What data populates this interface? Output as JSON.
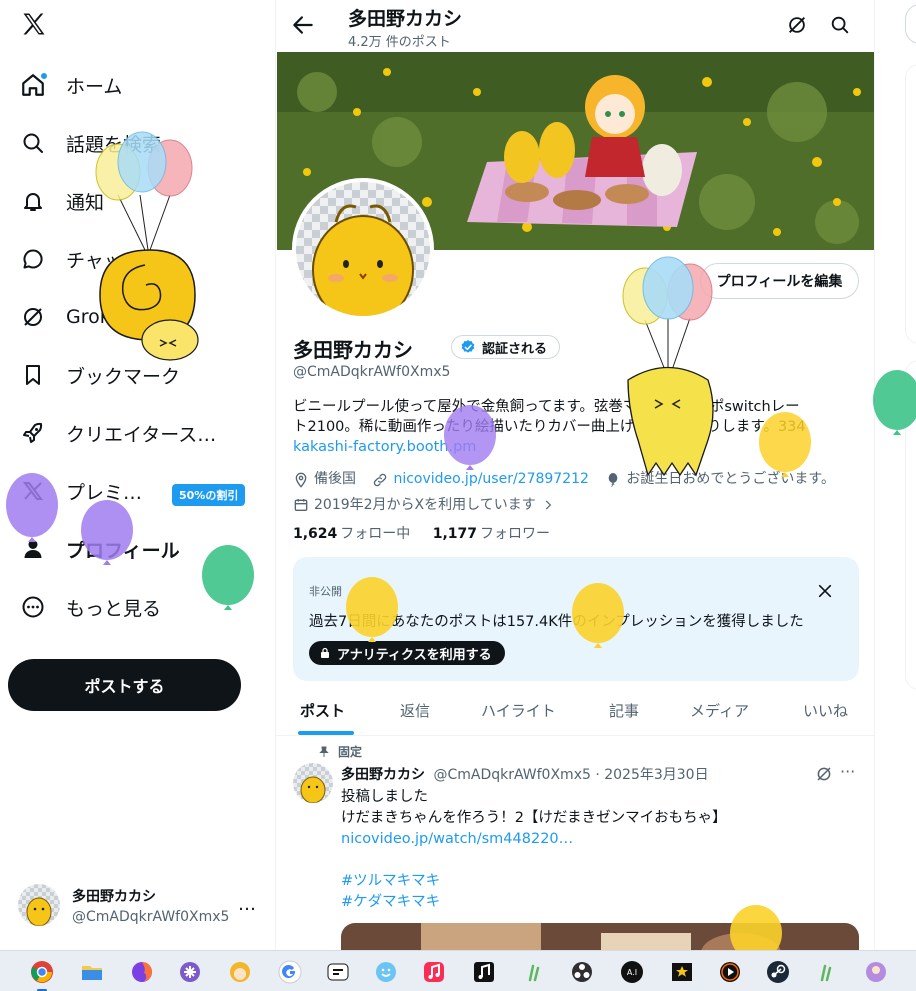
{
  "sidebar": {
    "logo": "x-logo-icon",
    "items": [
      {
        "label": "ホーム",
        "icon": "home-icon"
      },
      {
        "label": "話題を検索",
        "icon": "search-icon"
      },
      {
        "label": "通知",
        "icon": "bell-icon"
      },
      {
        "label": "チャット",
        "icon": "chat-icon"
      },
      {
        "label": "Grok",
        "icon": "grok-icon"
      },
      {
        "label": "ブックマーク",
        "icon": "bookmark-icon"
      },
      {
        "label": "クリエイタース…",
        "icon": "rocket-icon"
      },
      {
        "label": "プレミ…",
        "icon": "x-premium-icon"
      },
      {
        "label": "プロフィール",
        "icon": "person-icon"
      },
      {
        "label": "もっと見る",
        "icon": "more-circle-icon"
      }
    ],
    "premium_badge": "50%の割引",
    "post_button": "ポストする",
    "account": {
      "name": "多田野カカシ",
      "handle": "@CmADqkrAWf0Xmx5",
      "more": "…"
    }
  },
  "header": {
    "title": "多田野カカシ",
    "post_count": "4.2万 件のポスト"
  },
  "profile": {
    "edit_button": "プロフィールを編集",
    "name": "多田野カカシ",
    "verified_label": "認証される",
    "handle": "@CmADqkrAWf0Xmx5",
    "bio_line1": "ビニールプール使って屋外で金魚飼ってます。弦巻マキのぷよスポswitchレー",
    "bio_line2": "ト2100。稀に動画作ったり絵描いたりカバー曲上げたり歌ったりします。334",
    "bio_link": "kakashi-factory.booth.pm",
    "location": "備後国",
    "website": "nicovideo.jp/user/27897212",
    "birthday": "お誕生日おめでとうございます。",
    "joined": "2019年2月からXを利用しています",
    "following_count": "1,624",
    "following_label": "フォロー中",
    "followers_count": "1,177",
    "followers_label": "フォロワー"
  },
  "analytics": {
    "private_label": "非公開",
    "message": "過去7日間にあなたのポストは157.4K件のインプレッションを獲得しました",
    "button": "アナリティクスを利用する"
  },
  "tabs": [
    "ポスト",
    "返信",
    "ハイライト",
    "記事",
    "メディア",
    "いいね"
  ],
  "tweet": {
    "pinned_label": "固定",
    "author": "多田野カカシ",
    "handle_date": "@CmADqkrAWf0Xmx5 · 2025年3月30日",
    "line1": "投稿しました",
    "line2": "けだまきちゃんを作ろう！2【けだまきゼンマイおもちゃ】",
    "link": "nicovideo.jp/watch/sm448220…",
    "tag1": "#ツルマキマキ",
    "tag2": "#ケダマキマキ",
    "more": "···"
  },
  "taskbar": {
    "apps": [
      "chrome-icon",
      "file-explorer-icon",
      "firefox-icon",
      "app-purple-icon",
      "character-icon",
      "google-icon",
      "app-messenger-icon",
      "emoji-icon",
      "music-icon",
      "itunes-icon",
      "utau-icon",
      "obs-icon",
      "ai-voice-icon",
      "movie-star-icon",
      "player-icon",
      "steam-icon",
      "utau2-icon",
      "avatar-app-icon"
    ]
  },
  "colors": {
    "accent": "#1d9bf0",
    "text": "#0f1419",
    "muted": "#536471",
    "analytics_bg": "#e8f5fd"
  }
}
